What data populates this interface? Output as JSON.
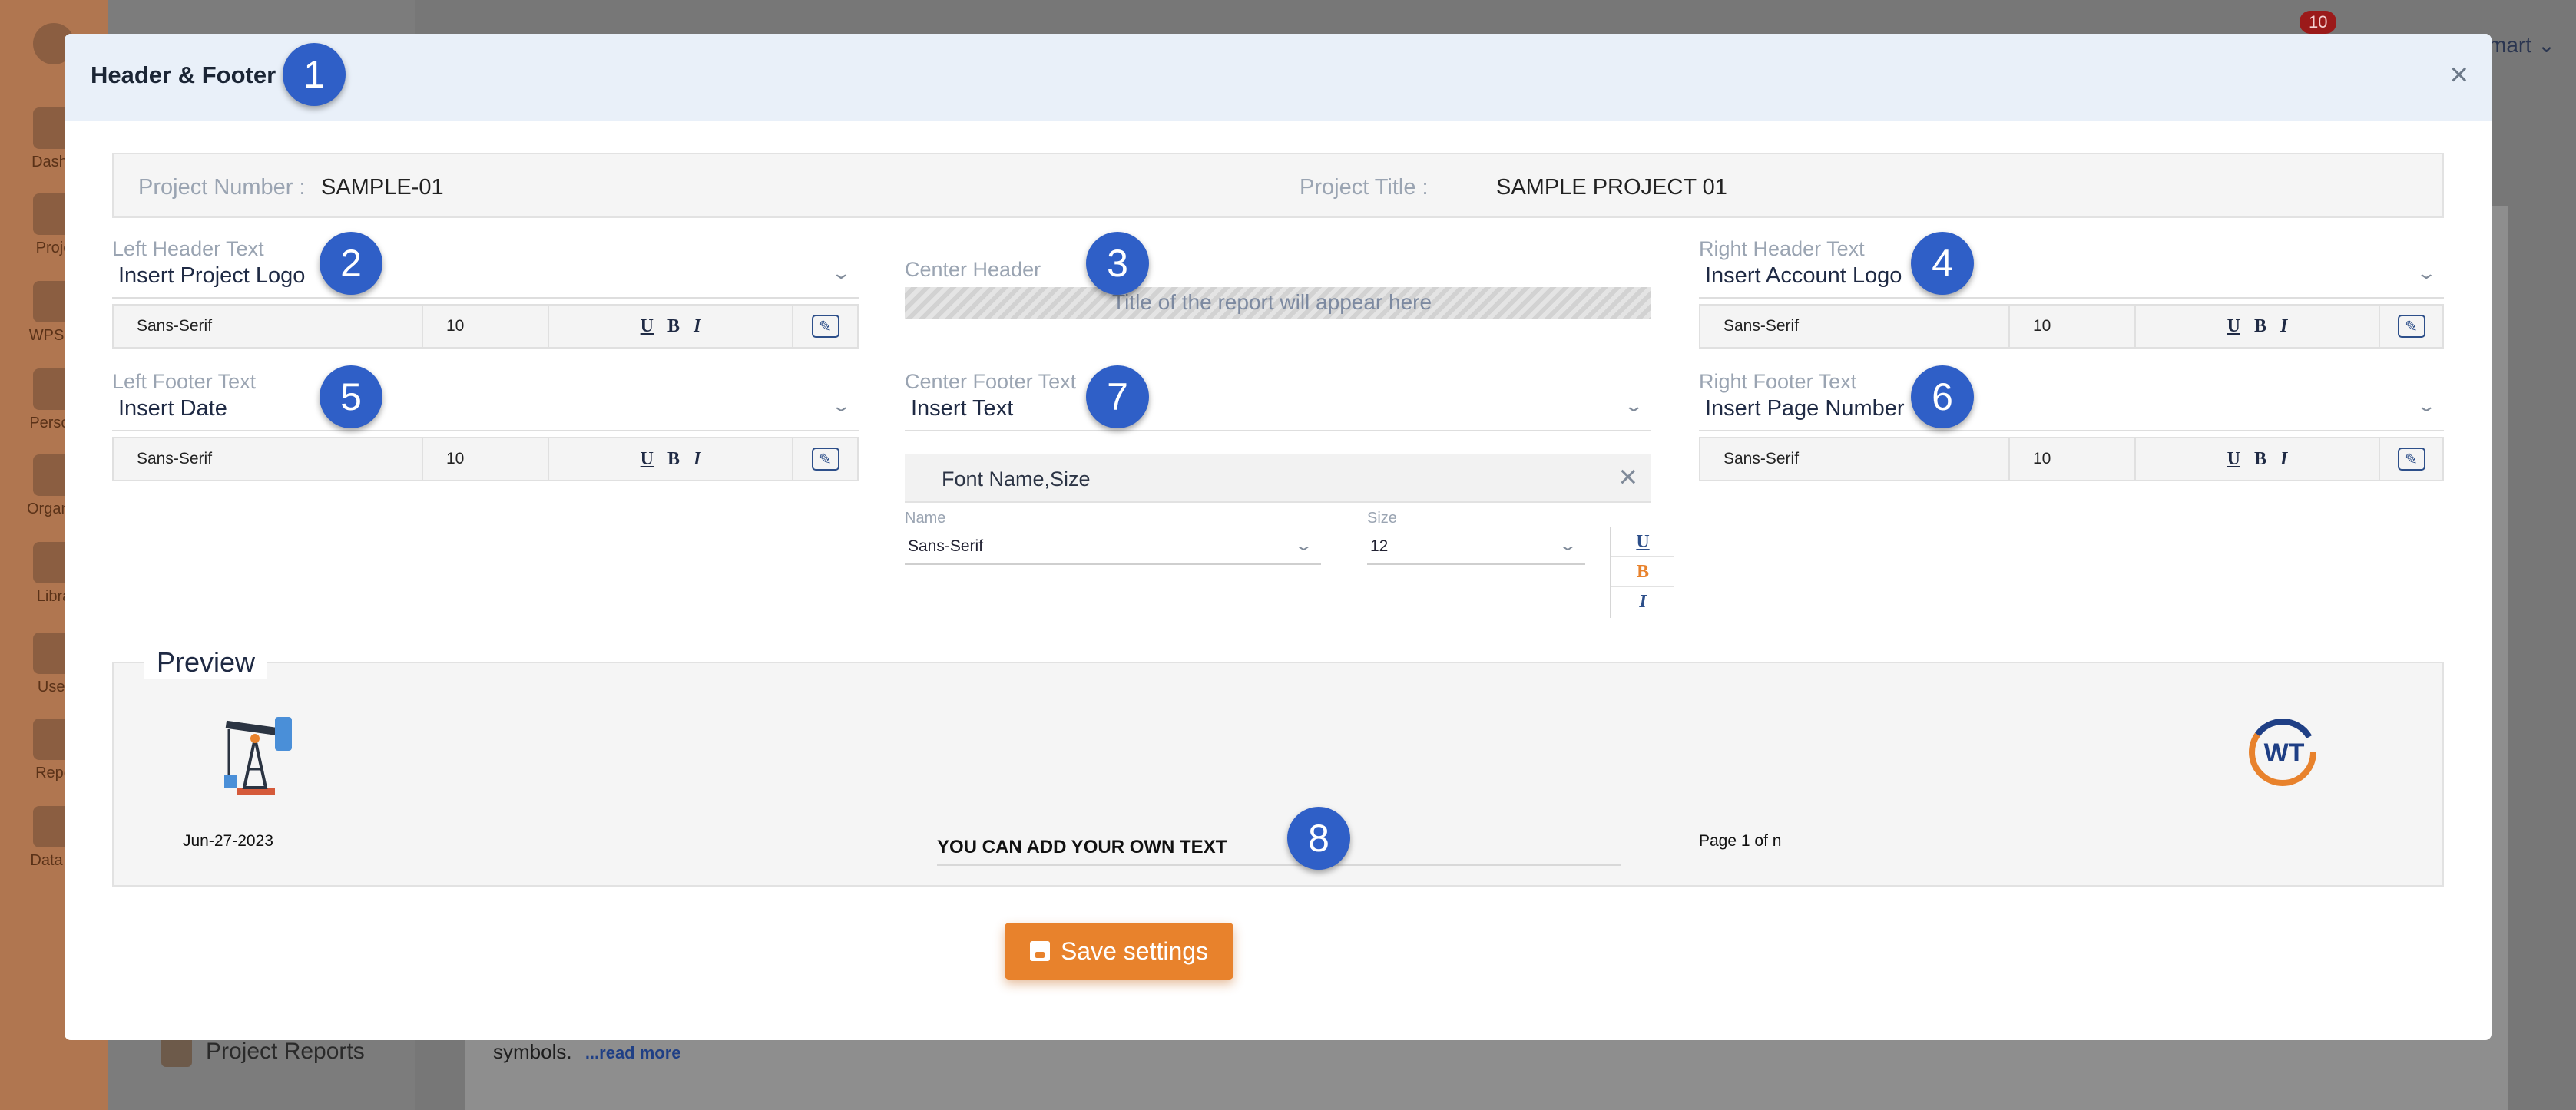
{
  "background": {
    "sidebar_items": [
      "Dashb",
      "Proje",
      "WPS &",
      "Person",
      "Organiz",
      "Libra",
      "User",
      "Repo",
      "Data B"
    ],
    "nav_item_project_reports": "Project Reports",
    "notification_count": "10",
    "user_name": "mart",
    "snippet_text": "symbols.",
    "read_more": "...read more"
  },
  "modal": {
    "title": "Header & Footer",
    "close_symbol": "×",
    "markers": [
      "1",
      "2",
      "3",
      "4",
      "5",
      "6",
      "7",
      "8"
    ],
    "project_number_label": "Project Number :",
    "project_number_value": "SAMPLE-01",
    "project_title_label": "Project Title :",
    "project_title_value": "SAMPLE PROJECT 01",
    "left_header": {
      "label": "Left Header Text",
      "value": "Insert Project Logo",
      "font": "Sans-Serif",
      "size": "10"
    },
    "center_header": {
      "label": "Center Header",
      "placeholder": "Title of the report will appear here"
    },
    "right_header": {
      "label": "Right Header Text",
      "value": "Insert Account Logo",
      "font": "Sans-Serif",
      "size": "10"
    },
    "left_footer": {
      "label": "Left Footer Text",
      "value": "Insert Date",
      "font": "Sans-Serif",
      "size": "10"
    },
    "center_footer": {
      "label": "Center Footer Text",
      "value": "Insert Text",
      "panel_title": "Font Name,Size",
      "name_label": "Name",
      "name_value": "Sans-Serif",
      "size_label": "Size",
      "size_value": "12"
    },
    "right_footer": {
      "label": "Right Footer Text",
      "value": "Insert Page Number",
      "font": "Sans-Serif",
      "size": "10"
    },
    "format_buttons": {
      "underline": "U",
      "bold": "B",
      "italic": "I"
    },
    "format_colors": {
      "underline": "#2d4f8a",
      "bold": "#e8822c",
      "italic": "#2d4f8a"
    },
    "preview": {
      "legend": "Preview",
      "left_footer": "Jun-27-2023",
      "center_footer": "YOU CAN ADD YOUR OWN TEXT",
      "right_footer": "Page 1 of n",
      "logo_text": "WT"
    },
    "save_label": "Save settings"
  },
  "colors": {
    "accent": "#e8822c",
    "marker": "#2f5fc7",
    "header_bg": "#e9f0f9"
  },
  "icons": [
    "oil-pump-icon",
    "company-logo-icon",
    "edit-icon",
    "floppy-disk-icon",
    "chevron-down-icon",
    "close-icon"
  ]
}
